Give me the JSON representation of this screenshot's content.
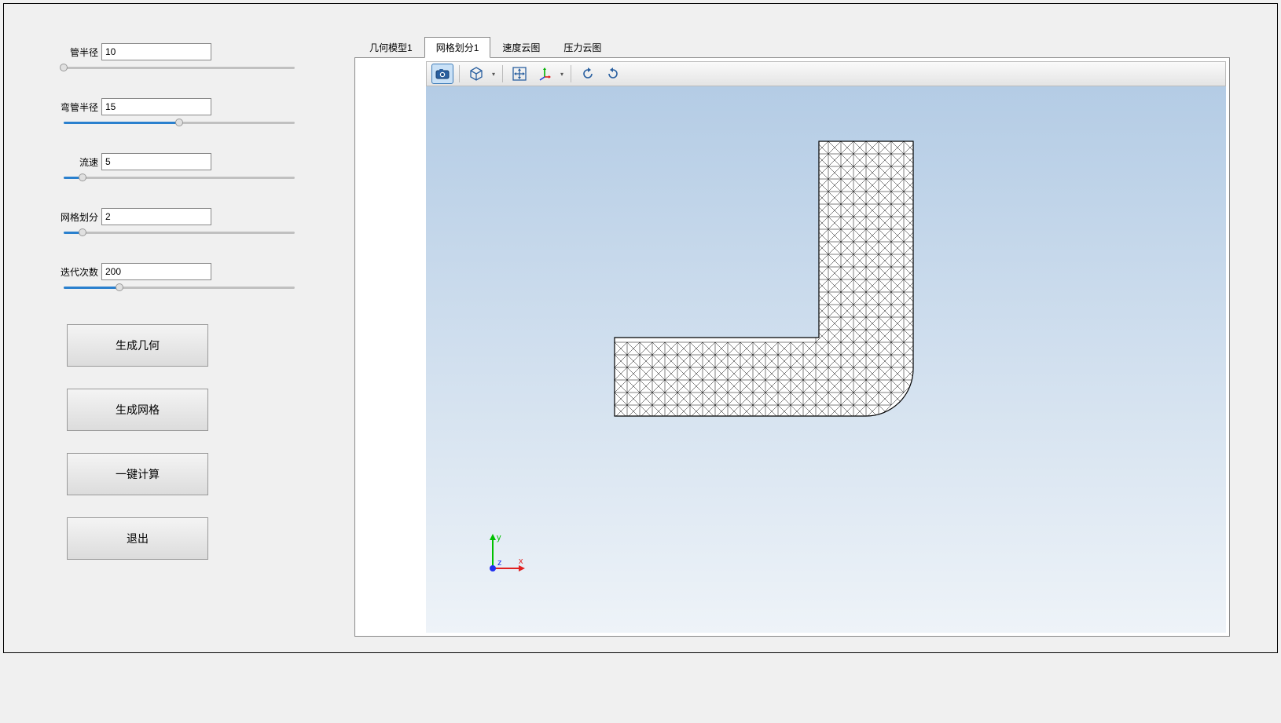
{
  "params": {
    "pipe_radius": {
      "label": "管半径",
      "value": "10",
      "percent": 0
    },
    "bend_radius": {
      "label": "弯管半径",
      "value": "15",
      "percent": 50
    },
    "velocity": {
      "label": "流速",
      "value": "5",
      "percent": 8
    },
    "mesh": {
      "label": "网格划分",
      "value": "2",
      "percent": 8
    },
    "iterations": {
      "label": "迭代次数",
      "value": "200",
      "percent": 24
    }
  },
  "buttons": {
    "gen_geom": "生成几何",
    "gen_mesh": "生成网格",
    "compute": "一键计算",
    "exit": "退出"
  },
  "tabs": {
    "geom": "几何模型1",
    "mesh": "网格划分1",
    "vel": "速度云图",
    "pres": "压力云图",
    "active": "mesh"
  },
  "axes": {
    "x": "x",
    "y": "y",
    "z": "z"
  },
  "toolbar_icons": {
    "camera": "camera-icon",
    "cube": "cube-icon",
    "move": "move-icon",
    "axes": "axes-icon",
    "rot_cw": "rotate-cw-icon",
    "rot_ccw": "rotate-ccw-icon"
  }
}
